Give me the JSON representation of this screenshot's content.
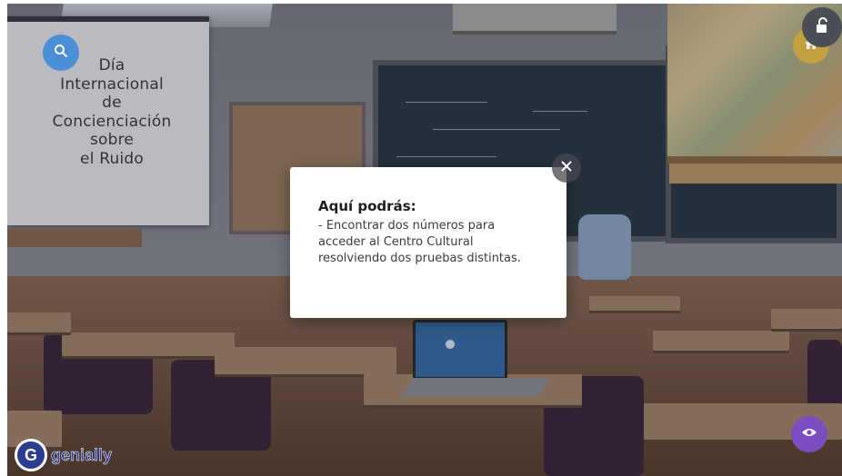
{
  "slide": {
    "title_text": "Día\nInternacional\nde\nConcienciación\nsobre\nel Ruido"
  },
  "modal": {
    "heading": "Aquí podrás:",
    "body": "- Encontrar dos números para\nacceder al Centro Cultural\nresolviendo dos pruebas distintas."
  },
  "brand": {
    "name": "genially"
  },
  "buttons": {
    "search_icon": "search-icon",
    "home_icon": "home-icon",
    "unlock_icon": "unlock-icon",
    "view_icon": "eye-icon",
    "close_icon": "close-icon"
  },
  "colors": {
    "search_button": "#4b8fd8",
    "home_button": "#c9a33a",
    "eye_button": "#7b4fc0",
    "brand": "#2b3d8f",
    "modal_background": "#ffffff"
  }
}
